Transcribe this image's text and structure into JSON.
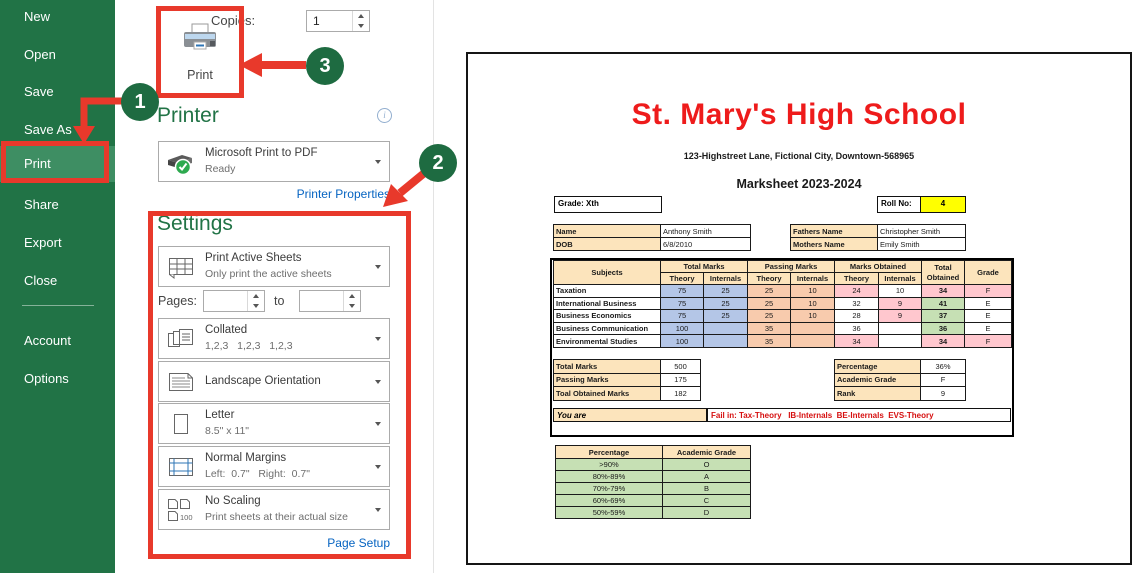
{
  "colors": {
    "sidebar_green": "#217346",
    "selected_item_green": "#3e8e63",
    "annotation_red": "#e8392b",
    "step_circle_green": "#1e6b41",
    "link_blue": "#0563c1",
    "heading_green": "#217346",
    "title_red": "#ee1b1b",
    "fail_text_red": "#d60f0f",
    "roll_highlight_yellow": "#ffff00",
    "cell_blue": "#b4c6e7",
    "cell_orange": "#f8cbad",
    "cell_pink": "#ffc7ce",
    "cell_green": "#c6e0b4",
    "cell_tan": "#fce4bc"
  },
  "sidebar": {
    "items": [
      "New",
      "Open",
      "Save",
      "Save As",
      "Print",
      "Share",
      "Export",
      "Close",
      "Account",
      "Options"
    ],
    "active_item": "Print"
  },
  "print_bar": {
    "copies_label": "Copies:",
    "copies_value": "1",
    "print_button_label": "Print"
  },
  "printer_section": {
    "heading": "Printer",
    "device_name": "Microsoft Print to PDF",
    "device_status": "Ready",
    "properties_link": "Printer Properties",
    "info_icon_glyph": "i"
  },
  "settings": {
    "heading": "Settings",
    "pages_label": "Pages:",
    "pages_to_label": "to",
    "pages_from_value": "",
    "pages_to_value": "",
    "page_setup_link": "Page Setup",
    "items": [
      {
        "icon": "print-active-sheets-icon",
        "title": "Print Active Sheets",
        "subtitle": "Only print the active sheets"
      },
      {
        "icon": "collated-icon",
        "title": "Collated",
        "subtitle": "1,2,3   1,2,3   1,2,3"
      },
      {
        "icon": "landscape-orientation-icon",
        "title": "Landscape Orientation",
        "subtitle": ""
      },
      {
        "icon": "paper-size-letter-icon",
        "title": "Letter",
        "subtitle": "8.5\" x 11\""
      },
      {
        "icon": "normal-margins-icon",
        "title": "Normal Margins",
        "subtitle": "Left:  0.7\"   Right:  0.7\""
      },
      {
        "icon": "no-scaling-icon",
        "title": "No Scaling",
        "subtitle": "Print sheets at their actual size"
      }
    ]
  },
  "annotations": {
    "steps": [
      "1",
      "2",
      "3"
    ]
  },
  "preview": {
    "school_name": "St. Mary's High School",
    "address": "123-Highstreet Lane, Fictional City, Downtown-568965",
    "sheet_title": "Marksheet 2023-2024",
    "grade_label": "Grade: Xth",
    "roll_label": "Roll No:",
    "roll_value": "4",
    "student_info_left": [
      [
        "Name",
        "Anthony Smith"
      ],
      [
        "DOB",
        "6/8/2010"
      ]
    ],
    "student_info_right": [
      [
        "Fathers Name",
        "Christopher Smith"
      ],
      [
        "Mothers Name",
        "Emily Smith"
      ]
    ],
    "marks_table": {
      "col_groups": [
        "Subjects",
        "Total Marks",
        "Passing Marks",
        "Marks Obtained",
        "Total Obtained",
        "Grade"
      ],
      "sub_headers": [
        "Theory",
        "Internals",
        "Theory",
        "Internals",
        "Theory",
        "Internals"
      ],
      "rows": [
        {
          "subject": "Taxation",
          "cells": [
            {
              "t": "75",
              "s": "b"
            },
            {
              "t": "25",
              "s": "b"
            },
            {
              "t": "25",
              "s": "o"
            },
            {
              "t": "10",
              "s": "o"
            },
            {
              "t": "24",
              "s": "pr"
            },
            {
              "t": "10",
              "s": "w"
            },
            {
              "t": "34",
              "s": "prB"
            },
            {
              "t": "F",
              "s": "pr"
            }
          ]
        },
        {
          "subject": "International Business",
          "cells": [
            {
              "t": "75",
              "s": "b"
            },
            {
              "t": "25",
              "s": "b"
            },
            {
              "t": "25",
              "s": "o"
            },
            {
              "t": "10",
              "s": "o"
            },
            {
              "t": "32",
              "s": "w"
            },
            {
              "t": "9",
              "s": "pr"
            },
            {
              "t": "41",
              "s": "gB"
            },
            {
              "t": "E",
              "s": "w"
            }
          ]
        },
        {
          "subject": "Business Economics",
          "cells": [
            {
              "t": "75",
              "s": "b"
            },
            {
              "t": "25",
              "s": "b"
            },
            {
              "t": "25",
              "s": "o"
            },
            {
              "t": "10",
              "s": "o"
            },
            {
              "t": "28",
              "s": "w"
            },
            {
              "t": "9",
              "s": "pr"
            },
            {
              "t": "37",
              "s": "gB"
            },
            {
              "t": "E",
              "s": "w"
            }
          ]
        },
        {
          "subject": "Business Communication",
          "cells": [
            {
              "t": "100",
              "s": "b"
            },
            {
              "t": "",
              "s": "b"
            },
            {
              "t": "35",
              "s": "o"
            },
            {
              "t": "",
              "s": "o"
            },
            {
              "t": "36",
              "s": "w"
            },
            {
              "t": "",
              "s": "w"
            },
            {
              "t": "36",
              "s": "gB"
            },
            {
              "t": "E",
              "s": "w"
            }
          ]
        },
        {
          "subject": "Environmental Studies",
          "cells": [
            {
              "t": "100",
              "s": "b"
            },
            {
              "t": "",
              "s": "b"
            },
            {
              "t": "35",
              "s": "o"
            },
            {
              "t": "",
              "s": "o"
            },
            {
              "t": "34",
              "s": "pr"
            },
            {
              "t": "",
              "s": "w"
            },
            {
              "t": "34",
              "s": "prB"
            },
            {
              "t": "F",
              "s": "pr"
            }
          ]
        }
      ]
    },
    "summary_left": [
      [
        "Total Marks",
        "500"
      ],
      [
        "Passing Marks",
        "175"
      ],
      [
        "Toal Obtained Marks",
        "182"
      ]
    ],
    "summary_right": [
      [
        "Percentage",
        "36%"
      ],
      [
        "Academic Grade",
        "F"
      ],
      [
        "Rank",
        "9"
      ]
    ],
    "you_are_label": "You are",
    "fail_message": "Fail in: Tax-Theory   IB-Internals  BE-Internals  EVS-Theory",
    "grade_scale": {
      "headers": [
        "Percentage",
        "Academic Grade"
      ],
      "rows": [
        [
          ">90%",
          "O"
        ],
        [
          "80%-89%",
          "A"
        ],
        [
          "70%-79%",
          "B"
        ],
        [
          "60%-69%",
          "C"
        ],
        [
          "50%-59%",
          "D"
        ]
      ]
    }
  }
}
